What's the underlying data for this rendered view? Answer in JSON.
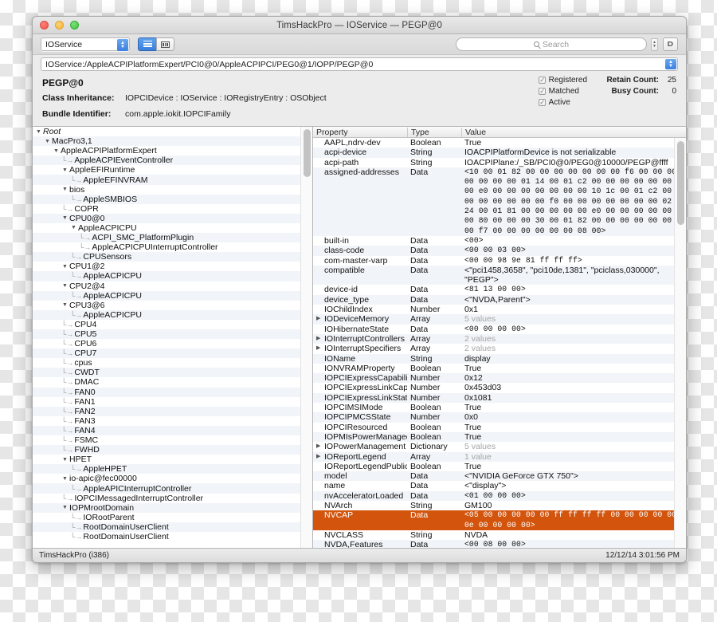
{
  "window": {
    "title": "TimsHackPro — IOService — PEGP@0",
    "traffic_lights": [
      "close",
      "minimize",
      "maximize"
    ]
  },
  "toolbar": {
    "plane_popup_value": "IOService",
    "view_list_label": "list-view",
    "view_column_label": "column-view",
    "search_placeholder": "Search",
    "pin_label": "⫐"
  },
  "pathbar": {
    "value": "IOService:/AppleACPIPlatformExpert/PCI0@0/AppleACPIPCI/PEG0@1/IOPP/PEGP@0"
  },
  "info": {
    "object_title": "PEGP@0",
    "class_inheritance_label": "Class Inheritance:",
    "class_inheritance_value": "IOPCIDevice : IOService : IORegistryEntry : OSObject",
    "bundle_label": "Bundle Identifier:",
    "bundle_value": "com.apple.iokit.IOPCIFamily",
    "flags": [
      {
        "label": "Registered",
        "checked": true
      },
      {
        "label": "Matched",
        "checked": true
      },
      {
        "label": "Active",
        "checked": true
      }
    ],
    "counts": [
      {
        "label": "Retain Count:",
        "value": "25"
      },
      {
        "label": "Busy Count:",
        "value": "0"
      }
    ]
  },
  "tree": {
    "nodes": [
      {
        "depth": 0,
        "label": "Root",
        "expanded": true,
        "italic": true
      },
      {
        "depth": 1,
        "label": "MacPro3,1",
        "expanded": true
      },
      {
        "depth": 2,
        "label": "AppleACPIPlatformExpert",
        "expanded": true
      },
      {
        "depth": 3,
        "label": "AppleACPIEventController",
        "leaf": true
      },
      {
        "depth": 3,
        "label": "AppleEFIRuntime",
        "expanded": true
      },
      {
        "depth": 4,
        "label": "AppleEFINVRAM",
        "leaf": true
      },
      {
        "depth": 3,
        "label": "bios",
        "expanded": true
      },
      {
        "depth": 4,
        "label": "AppleSMBIOS",
        "leaf": true
      },
      {
        "depth": 3,
        "label": "COPR",
        "leaf": true
      },
      {
        "depth": 3,
        "label": "CPU0@0",
        "expanded": true
      },
      {
        "depth": 4,
        "label": "AppleACPICPU",
        "expanded": true
      },
      {
        "depth": 5,
        "label": "ACPI_SMC_PlatformPlugin",
        "leaf": true
      },
      {
        "depth": 5,
        "label": "AppleACPICPUInterruptController",
        "leaf": true
      },
      {
        "depth": 4,
        "label": "CPUSensors",
        "leaf": true
      },
      {
        "depth": 3,
        "label": "CPU1@2",
        "expanded": true
      },
      {
        "depth": 4,
        "label": "AppleACPICPU",
        "leaf": true
      },
      {
        "depth": 3,
        "label": "CPU2@4",
        "expanded": true
      },
      {
        "depth": 4,
        "label": "AppleACPICPU",
        "leaf": true
      },
      {
        "depth": 3,
        "label": "CPU3@6",
        "expanded": true
      },
      {
        "depth": 4,
        "label": "AppleACPICPU",
        "leaf": true
      },
      {
        "depth": 3,
        "label": "CPU4",
        "leaf": true
      },
      {
        "depth": 3,
        "label": "CPU5",
        "leaf": true
      },
      {
        "depth": 3,
        "label": "CPU6",
        "leaf": true
      },
      {
        "depth": 3,
        "label": "CPU7",
        "leaf": true
      },
      {
        "depth": 3,
        "label": "cpus",
        "leaf": true
      },
      {
        "depth": 3,
        "label": "CWDT",
        "leaf": true
      },
      {
        "depth": 3,
        "label": "DMAC",
        "leaf": true
      },
      {
        "depth": 3,
        "label": "FAN0",
        "leaf": true
      },
      {
        "depth": 3,
        "label": "FAN1",
        "leaf": true
      },
      {
        "depth": 3,
        "label": "FAN2",
        "leaf": true
      },
      {
        "depth": 3,
        "label": "FAN3",
        "leaf": true
      },
      {
        "depth": 3,
        "label": "FAN4",
        "leaf": true
      },
      {
        "depth": 3,
        "label": "FSMC",
        "leaf": true
      },
      {
        "depth": 3,
        "label": "FWHD",
        "leaf": true
      },
      {
        "depth": 3,
        "label": "HPET",
        "expanded": true
      },
      {
        "depth": 4,
        "label": "AppleHPET",
        "leaf": true
      },
      {
        "depth": 3,
        "label": "io-apic@fec00000",
        "expanded": true
      },
      {
        "depth": 4,
        "label": "AppleAPICInterruptController",
        "leaf": true
      },
      {
        "depth": 3,
        "label": "IOPCIMessagedInterruptController",
        "leaf": true
      },
      {
        "depth": 3,
        "label": "IOPMrootDomain",
        "expanded": true
      },
      {
        "depth": 4,
        "label": "IORootParent",
        "leaf": true
      },
      {
        "depth": 4,
        "label": "RootDomainUserClient",
        "leaf": true
      },
      {
        "depth": 4,
        "label": "RootDomainUserClient",
        "leaf": true
      }
    ]
  },
  "properties": {
    "columns": [
      "Property",
      "Type",
      "Value"
    ],
    "rows": [
      {
        "name": "AAPL,ndrv-dev",
        "type": "Boolean",
        "value": "True"
      },
      {
        "name": "acpi-device",
        "type": "String",
        "value": "IOACPIPlatformDevice is not serializable"
      },
      {
        "name": "acpi-path",
        "type": "String",
        "value": "IOACPIPlane:/_SB/PCI0@0/PEG0@10000/PEGP@ffff"
      },
      {
        "name": "assigned-addresses",
        "type": "Data",
        "mono": true,
        "value": "<10 00 01 82 00 00 00 00 00 00 00 f6 00 00 00\n00 00 00 00 01 14 00 01 c2 00 00 00 00 00 00\n00 e0 00 00 00 00 00 00 00 10 1c 00 01 c2 00\n00 00 00 00 00 00 f0 00 00 00 00 00 00 00 02\n24 00 01 81 00 00 00 00 00 e0 00 00 00 00 00\n00 80 00 00 00 30 00 01 82 00 00 00 00 00 00\n00 f7 00 00 00 00 00 00 08 00>"
      },
      {
        "name": "built-in",
        "type": "Data",
        "mono": true,
        "value": "<00>"
      },
      {
        "name": "class-code",
        "type": "Data",
        "mono": true,
        "value": "<00 00 03 00>"
      },
      {
        "name": "com-master-varp",
        "type": "Data",
        "mono": true,
        "value": "<00 00 98 9e 81 ff ff ff>"
      },
      {
        "name": "compatible",
        "type": "Data",
        "value": "<\"pci1458,3658\", \"pci10de,1381\", \"pciclass,030000\", \"PEGP\">"
      },
      {
        "name": "device-id",
        "type": "Data",
        "mono": true,
        "value": "<81 13 00 00>"
      },
      {
        "name": "device_type",
        "type": "Data",
        "value": "<\"NVDA,Parent\">"
      },
      {
        "name": "IOChildIndex",
        "type": "Number",
        "value": "0x1"
      },
      {
        "name": "IODeviceMemory",
        "type": "Array",
        "value": "5 values",
        "muted": true,
        "disclosure": true
      },
      {
        "name": "IOHibernateState",
        "type": "Data",
        "mono": true,
        "value": "<00 00 00 00>"
      },
      {
        "name": "IOInterruptControllers",
        "type": "Array",
        "value": "2 values",
        "muted": true,
        "disclosure": true
      },
      {
        "name": "IOInterruptSpecifiers",
        "type": "Array",
        "value": "2 values",
        "muted": true,
        "disclosure": true
      },
      {
        "name": "IOName",
        "type": "String",
        "value": "display"
      },
      {
        "name": "IONVRAMProperty",
        "type": "Boolean",
        "value": "True"
      },
      {
        "name": "IOPCIExpressCapabilities",
        "type": "Number",
        "value": "0x12"
      },
      {
        "name": "IOPCIExpressLinkCapabilities",
        "type": "Number",
        "value": "0x453d03"
      },
      {
        "name": "IOPCIExpressLinkStatus",
        "type": "Number",
        "value": "0x1081"
      },
      {
        "name": "IOPCIMSIMode",
        "type": "Boolean",
        "value": "True"
      },
      {
        "name": "IOPCIPMCSState",
        "type": "Number",
        "value": "0x0"
      },
      {
        "name": "IOPCIResourced",
        "type": "Boolean",
        "value": "True"
      },
      {
        "name": "IOPMIsPowerManaged",
        "type": "Boolean",
        "value": "True"
      },
      {
        "name": "IOPowerManagement",
        "type": "Dictionary",
        "value": "5 values",
        "muted": true,
        "disclosure": true
      },
      {
        "name": "IOReportLegend",
        "type": "Array",
        "value": "1 value",
        "muted": true,
        "disclosure": true
      },
      {
        "name": "IOReportLegendPublic",
        "type": "Boolean",
        "value": "True"
      },
      {
        "name": "model",
        "type": "Data",
        "value": "<\"NVIDIA GeForce GTX 750\">"
      },
      {
        "name": "name",
        "type": "Data",
        "value": "<\"display\">"
      },
      {
        "name": "nvAcceleratorLoaded",
        "type": "Data",
        "mono": true,
        "value": "<01 00 00 00>"
      },
      {
        "name": "NVArch",
        "type": "String",
        "value": "GM100"
      },
      {
        "name": "NVCAP",
        "type": "Data",
        "mono": true,
        "selected": true,
        "value": "<05 00 00 00 00 00 ff ff ff ff 00 00 00 00 00\n0e 00 00 00 00>"
      },
      {
        "name": "NVCLASS",
        "type": "String",
        "value": "NVDA"
      },
      {
        "name": "NVDA,Features",
        "type": "Data",
        "mono": true,
        "value": "<00 08 00 00>"
      }
    ]
  },
  "statusbar": {
    "left": "TimsHackPro (i386)",
    "right": "12/12/14 3:01:56 PM"
  },
  "colors": {
    "selection": "#d2540d",
    "accent_blue": "#3b7fdd",
    "stripe": "#f1f4f8"
  }
}
